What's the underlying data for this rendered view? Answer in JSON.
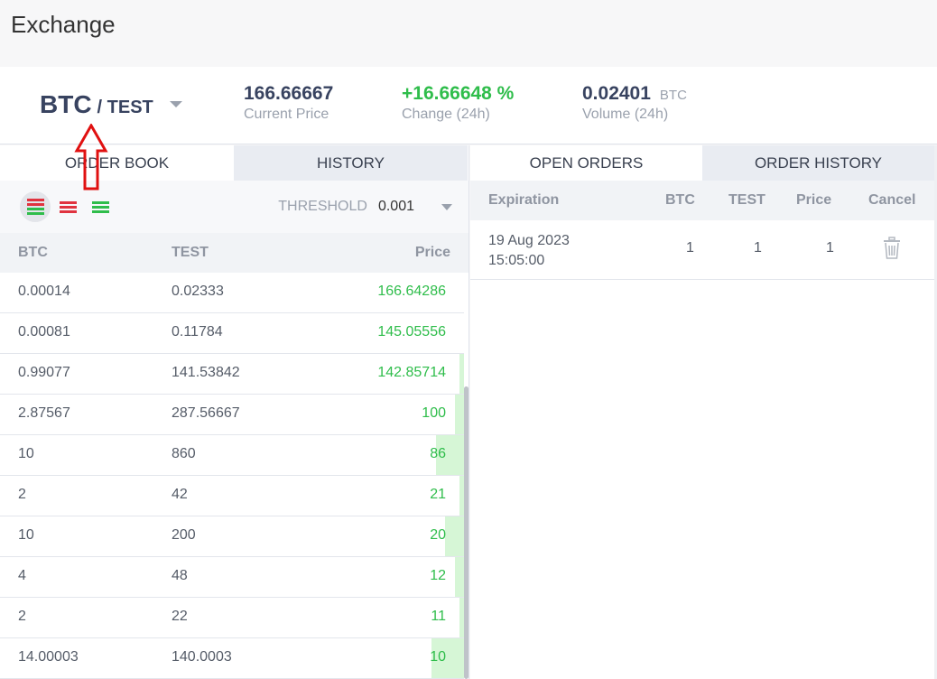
{
  "app": {
    "title": "Exchange"
  },
  "ticker": {
    "base": "BTC",
    "quote": "/ TEST",
    "current_price": {
      "value": "166.66667",
      "label": "Current Price"
    },
    "change": {
      "value": "+16.66648 %",
      "label": "Change (24h)"
    },
    "volume": {
      "value": "0.02401",
      "unit": "BTC",
      "label": "Volume (24h)"
    }
  },
  "left_tabs": [
    {
      "label": "ORDER BOOK"
    },
    {
      "label": "HISTORY"
    }
  ],
  "right_tabs": [
    {
      "label": "OPEN ORDERS"
    },
    {
      "label": "ORDER HISTORY"
    }
  ],
  "threshold": {
    "label": "THRESHOLD",
    "value": "0.001"
  },
  "order_book": {
    "columns": [
      "BTC",
      "TEST",
      "Price"
    ],
    "rows": [
      {
        "btc": "0.00014",
        "test": "0.02333",
        "price": "166.64286",
        "depth": 0.0
      },
      {
        "btc": "0.00081",
        "test": "0.11784",
        "price": "145.05556",
        "depth": 0.0
      },
      {
        "btc": "0.99077",
        "test": "141.53842",
        "price": "142.85714",
        "depth": 0.01
      },
      {
        "btc": "2.87567",
        "test": "287.56667",
        "price": "100",
        "depth": 0.02
      },
      {
        "btc": "10",
        "test": "860",
        "price": "86",
        "depth": 0.06
      },
      {
        "btc": "2",
        "test": "42",
        "price": "21",
        "depth": 0.01
      },
      {
        "btc": "10",
        "test": "200",
        "price": "20",
        "depth": 0.04
      },
      {
        "btc": "4",
        "test": "48",
        "price": "12",
        "depth": 0.02
      },
      {
        "btc": "2",
        "test": "22",
        "price": "11",
        "depth": 0.01
      },
      {
        "btc": "14.00003",
        "test": "140.0003",
        "price": "10",
        "depth": 0.07
      }
    ]
  },
  "open_orders": {
    "columns": [
      "Expiration",
      "BTC",
      "TEST",
      "Price",
      "Cancel"
    ],
    "rows": [
      {
        "date": "19 Aug 2023",
        "time": "15:05:00",
        "btc": "1",
        "test": "1",
        "price": "1"
      }
    ]
  },
  "colors": {
    "accent_green": "#2fbd4b",
    "accent_red": "#e0333f",
    "depth_green": "#d6f6d6"
  }
}
